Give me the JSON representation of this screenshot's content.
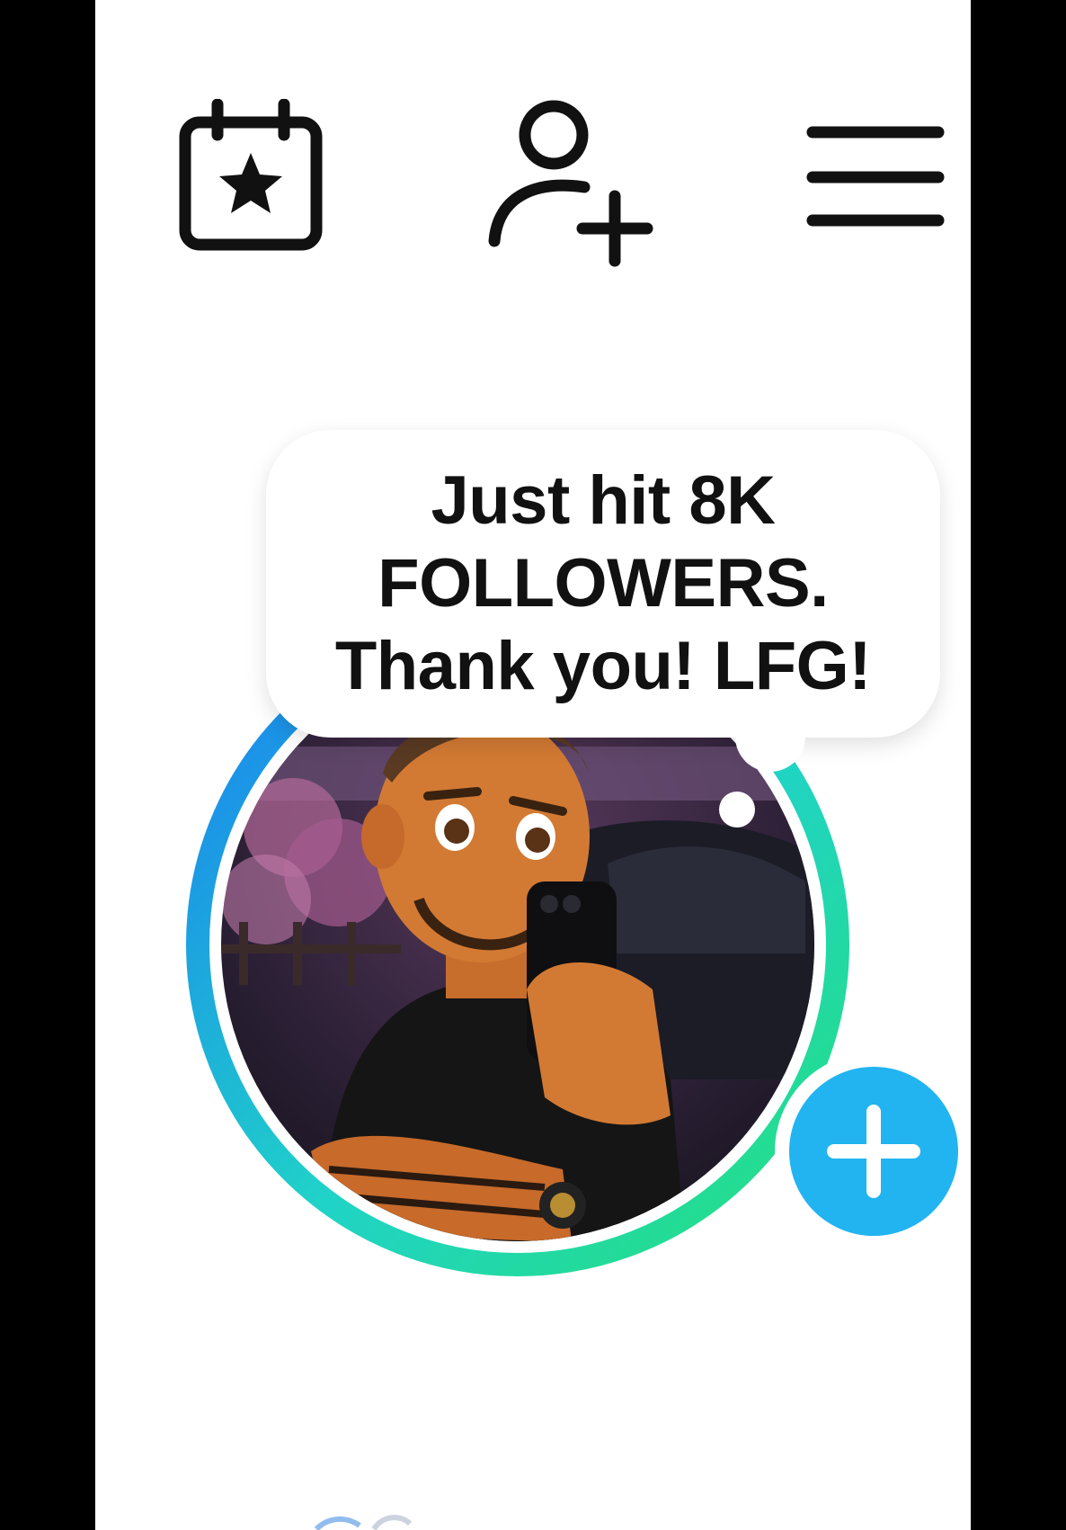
{
  "topbar": {
    "calendar_icon": "calendar-star-icon",
    "add_user_icon": "person-add-icon",
    "menu_icon": "hamburger-menu-icon"
  },
  "story_note": {
    "text": "Just hit 8K\nFOLLOWERS.\nThank you! LFG!"
  },
  "avatar": {
    "ring_colors": [
      "#1a7df2",
      "#20d3c8",
      "#25e07a"
    ],
    "description_icon": "profile-avatar"
  },
  "add_story_button": {
    "icon": "plus-icon",
    "color": "#22b4f0"
  },
  "colors": {
    "background": "#ffffff",
    "outer_frame": "#000000",
    "icon": "#111111"
  }
}
